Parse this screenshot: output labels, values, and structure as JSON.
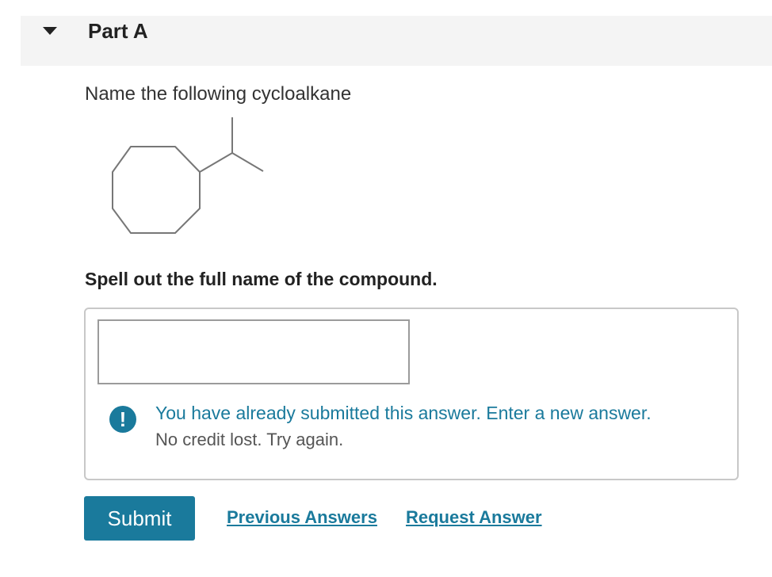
{
  "part": {
    "title": "Part A"
  },
  "question": {
    "prompt": "Name the following cycloalkane"
  },
  "instruction": "Spell out the full name of the compound.",
  "answer": {
    "value": "",
    "placeholder": ""
  },
  "feedback": {
    "icon": "exclamation-icon",
    "message": "You have already submitted this answer. Enter a new answer.",
    "subtext": "No credit lost. Try again."
  },
  "actions": {
    "submit_label": "Submit",
    "previous_answers_label": "Previous Answers",
    "request_answer_label": "Request Answer"
  },
  "colors": {
    "accent": "#1a7a9c",
    "header_bg": "#f4f4f4",
    "structure_lines": "#777777"
  }
}
